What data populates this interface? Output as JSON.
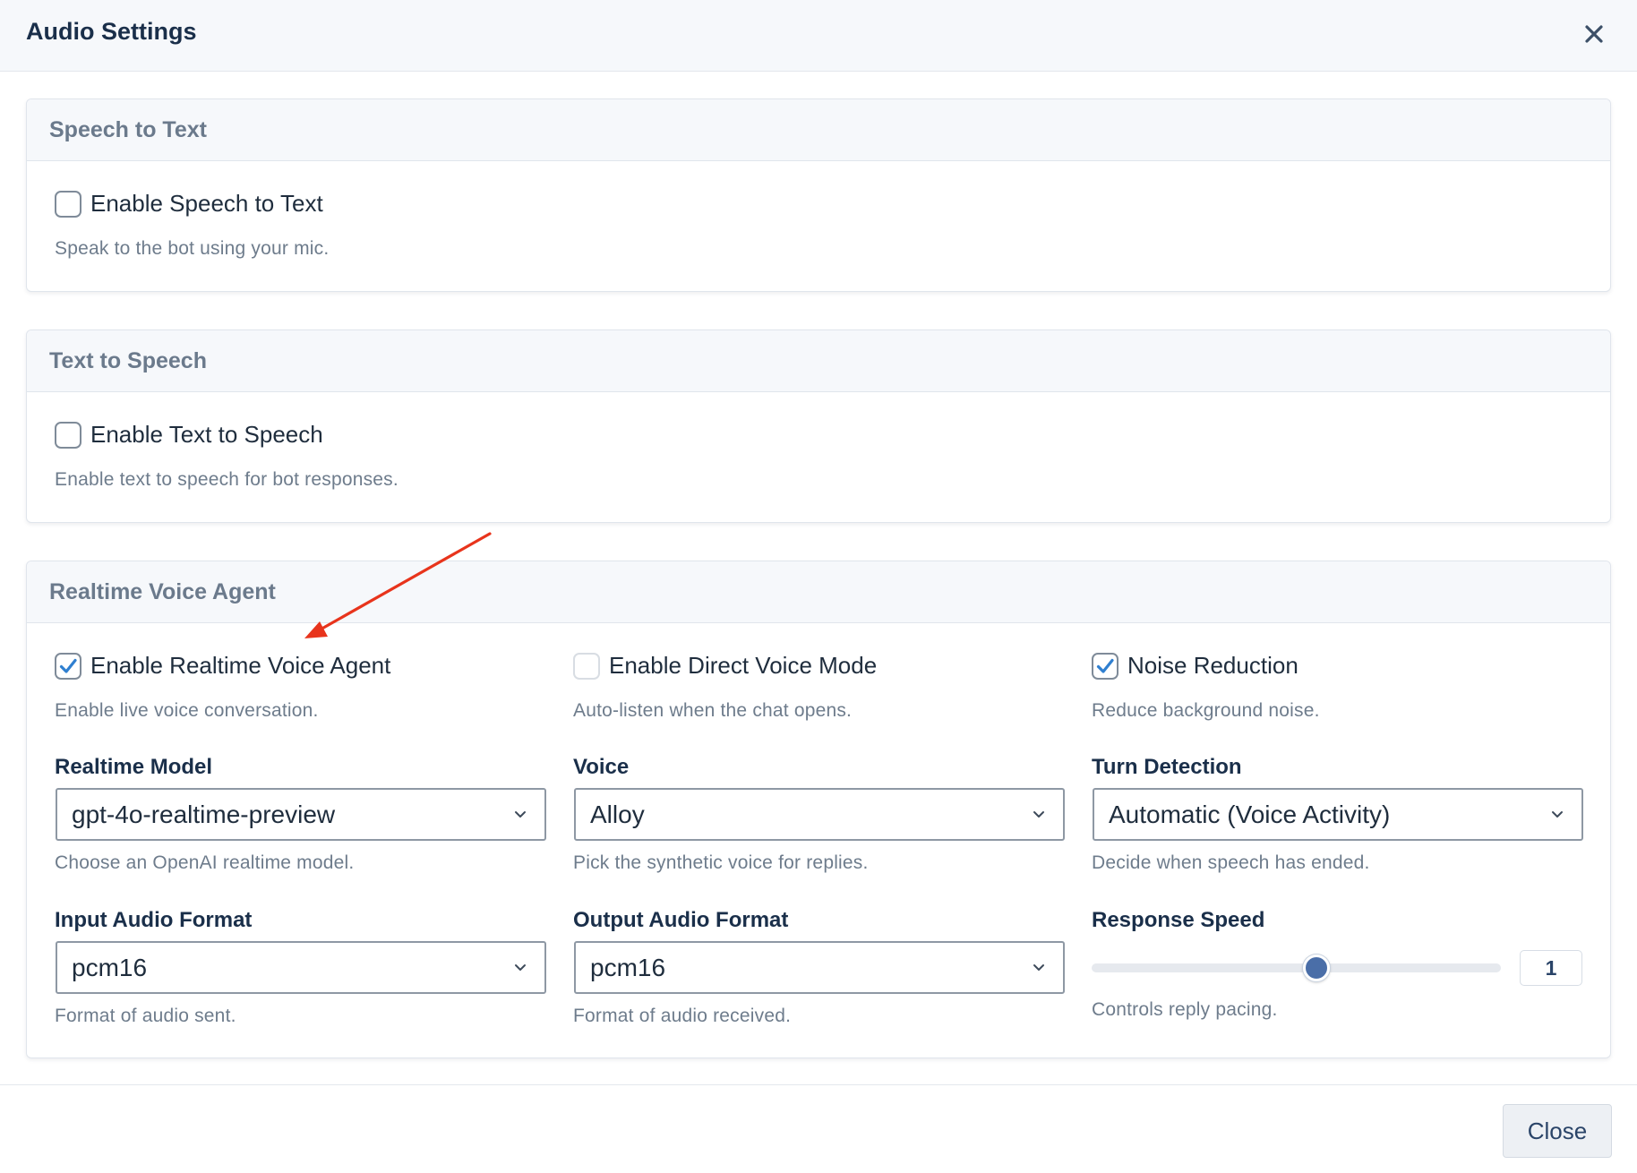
{
  "header": {
    "title": "Audio Settings"
  },
  "speech_to_text": {
    "title": "Speech to Text",
    "enable_label": "Enable Speech to Text",
    "enable_checked": false,
    "help": "Speak to the bot using your mic."
  },
  "text_to_speech": {
    "title": "Text to Speech",
    "enable_label": "Enable Text to Speech",
    "enable_checked": false,
    "help": "Enable text to speech for bot responses."
  },
  "realtime": {
    "title": "Realtime Voice Agent",
    "enable_agent": {
      "label": "Enable Realtime Voice Agent",
      "checked": true,
      "help": "Enable live voice conversation."
    },
    "direct_mode": {
      "label": "Enable Direct Voice Mode",
      "checked": false,
      "help": "Auto-listen when the chat opens."
    },
    "noise_reduction": {
      "label": "Noise Reduction",
      "checked": true,
      "help": "Reduce background noise."
    },
    "model": {
      "label": "Realtime Model",
      "value": "gpt-4o-realtime-preview",
      "help": "Choose an OpenAI realtime model."
    },
    "voice": {
      "label": "Voice",
      "value": "Alloy",
      "help": "Pick the synthetic voice for replies."
    },
    "turn_detection": {
      "label": "Turn Detection",
      "value": "Automatic (Voice Activity)",
      "help": "Decide when speech has ended."
    },
    "input_format": {
      "label": "Input Audio Format",
      "value": "pcm16",
      "help": "Format of audio sent."
    },
    "output_format": {
      "label": "Output Audio Format",
      "value": "pcm16",
      "help": "Format of audio received."
    },
    "response_speed": {
      "label": "Response Speed",
      "value": "1",
      "slider_fraction": 0.55,
      "help": "Controls reply pacing."
    }
  },
  "footer": {
    "close_label": "Close"
  },
  "icons": {
    "close": "close-icon",
    "check": "checkmark-icon",
    "chevron": "chevron-down-icon"
  },
  "colors": {
    "accent": "#4a6ea8",
    "check": "#2f7fd0",
    "annotation": "#e8341c"
  }
}
